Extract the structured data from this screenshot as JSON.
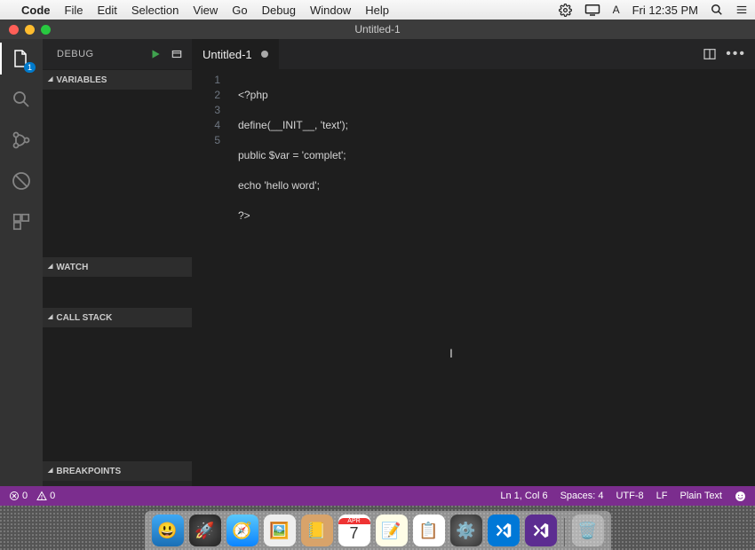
{
  "menubar": {
    "apple": "",
    "app": "Code",
    "items": [
      "File",
      "Edit",
      "Selection",
      "View",
      "Go",
      "Debug",
      "Window",
      "Help"
    ],
    "clock": "Fri 12:35 PM"
  },
  "titlebar": {
    "title": "Untitled-1"
  },
  "activitybar": {
    "explorer_badge": "1"
  },
  "sidebar": {
    "title": "DEBUG",
    "sections": {
      "variables": "Variables",
      "watch": "Watch",
      "callstack": "Call Stack",
      "breakpoints": "Breakpoints"
    }
  },
  "tab": {
    "label": "Untitled-1"
  },
  "editor": {
    "line_numbers": [
      "1",
      "2",
      "3",
      "4",
      "5"
    ],
    "lines": [
      {
        "raw": "<?php"
      },
      {
        "raw": "define(__INIT__, 'text');"
      },
      {
        "raw": "public $var = 'complet';"
      },
      {
        "raw": "echo 'hello word';"
      },
      {
        "raw": "?>"
      }
    ]
  },
  "statusbar": {
    "errors": "0",
    "warnings": "0",
    "position": "Ln 1, Col 6",
    "spaces": "Spaces: 4",
    "encoding": "UTF-8",
    "eol": "LF",
    "language": "Plain Text"
  },
  "dock": {
    "apps": [
      "finder",
      "launchpad",
      "safari",
      "preview",
      "contacts",
      "calendar",
      "notes",
      "reminders",
      "sysprefs",
      "vscode",
      "vstudio"
    ],
    "cal_day": "7"
  }
}
